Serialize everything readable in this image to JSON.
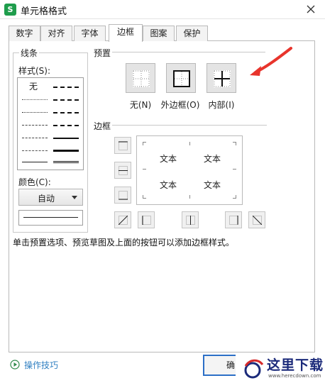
{
  "window": {
    "title": "单元格格式",
    "app_icon": "S"
  },
  "tabs": [
    "数字",
    "对齐",
    "字体",
    "边框",
    "图案",
    "保护"
  ],
  "active_tab": "边框",
  "line_group": {
    "title": "线条",
    "style_label": "样式(S):",
    "none_label": "无",
    "color_label": "颜色(C):",
    "color_value": "自动"
  },
  "preset_group": {
    "title": "预置",
    "items": [
      "无(N)",
      "外边框(O)",
      "内部(I)"
    ]
  },
  "border_group": {
    "title": "边框",
    "preview_text": [
      "文本",
      "文本",
      "文本",
      "文本"
    ]
  },
  "hint": "单击预置选项、预览草图及上面的按钮可以添加边框样式。",
  "footer": {
    "help_link": "操作技巧",
    "ok_button": "确"
  },
  "watermark": {
    "text": "这里下载",
    "url": "www.herecdown.com"
  },
  "colors": {
    "accent_arrow": "#e8342c",
    "green_icon": "#1f9d4c",
    "link": "#2f7fc1"
  }
}
